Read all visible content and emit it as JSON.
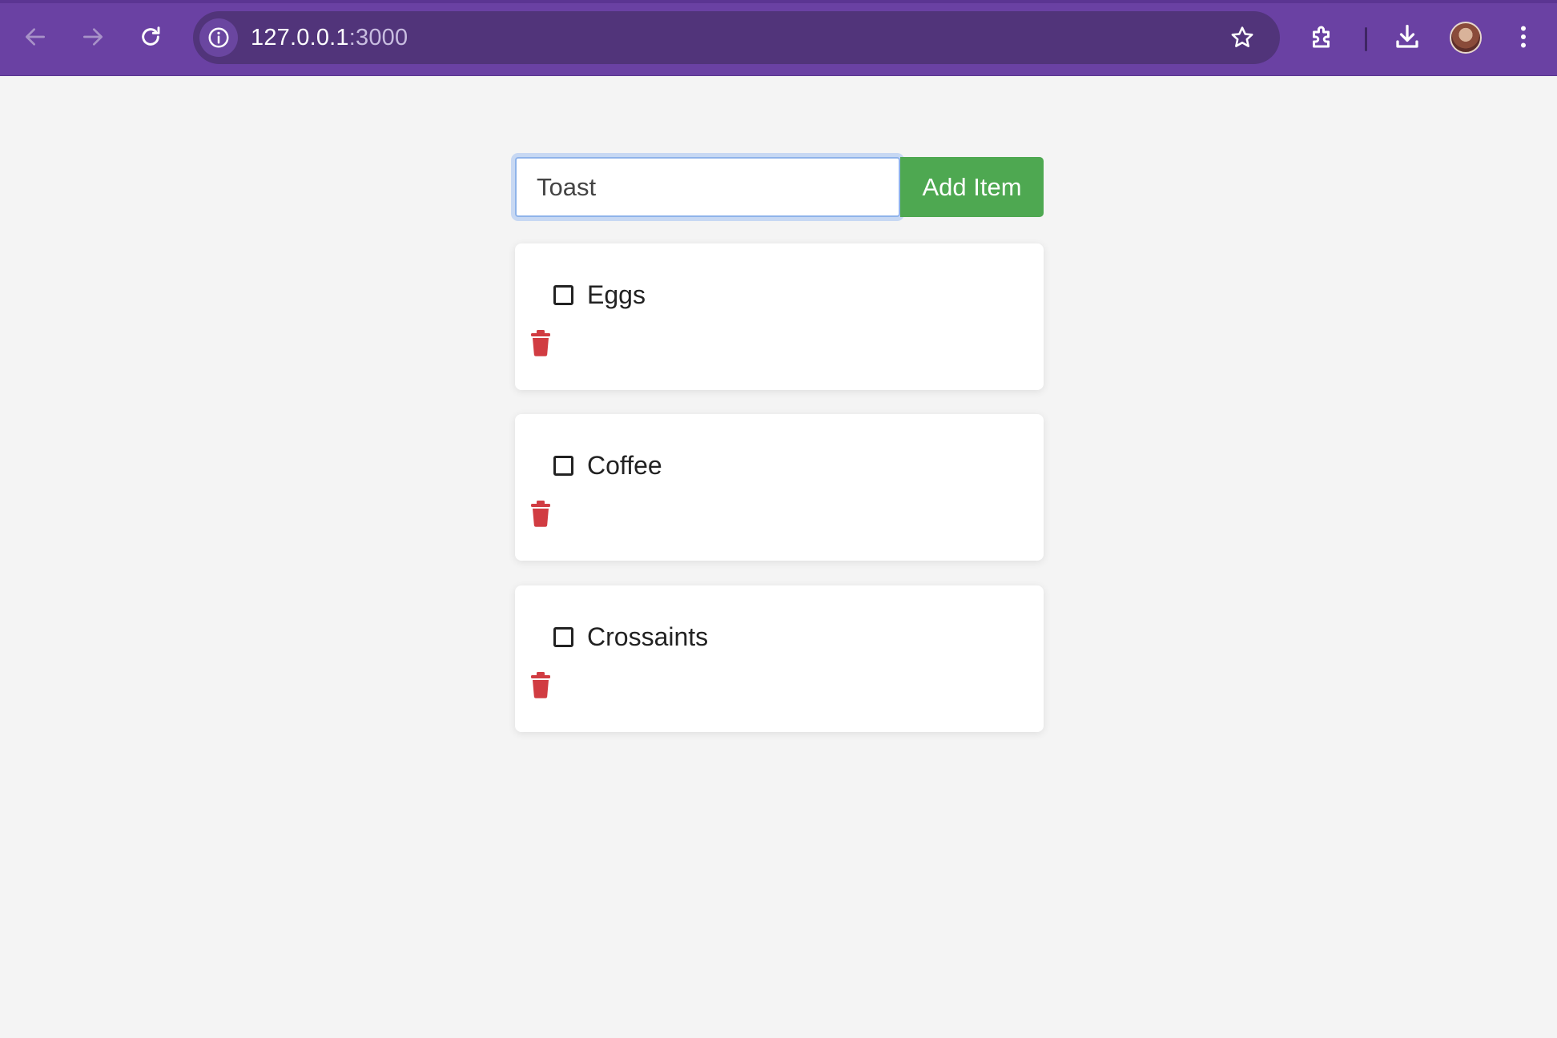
{
  "browser": {
    "url_host": "127.0.0.1",
    "url_port": ":3000",
    "accent_color": "#6a41a3",
    "icons": [
      "back-arrow-icon",
      "forward-arrow-icon",
      "reload-icon",
      "site-info-icon",
      "star-icon",
      "extensions-icon",
      "download-icon",
      "avatar",
      "more-menu-icon"
    ]
  },
  "form": {
    "input_value": "Toast",
    "add_button_label": "Add Item",
    "button_color": "#4ea851"
  },
  "items": [
    {
      "label": "Eggs",
      "checked": false
    },
    {
      "label": "Coffee",
      "checked": false
    },
    {
      "label": "Crossaints",
      "checked": false
    }
  ],
  "delete_icon_color": "#d13c42"
}
